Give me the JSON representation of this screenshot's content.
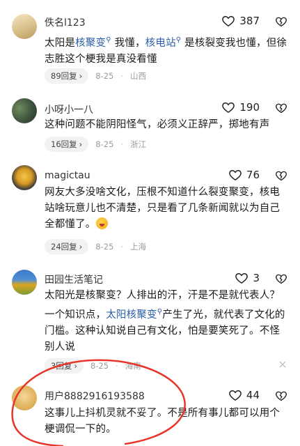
{
  "comments": [
    {
      "username": "佚名l123",
      "likes": "387",
      "text_parts": [
        "太阳是",
        "核聚变",
        "我懂，",
        "核电站",
        "是核裂变我也懂，但徐志胜这个梗我是真没看懂"
      ],
      "replies": "89回复",
      "date": "8-25",
      "location": "山西"
    },
    {
      "username": "小呀小一八",
      "likes": "190",
      "text": "这种问题不能阴阳怪气，必须义正辞严，掷地有声",
      "replies": "16回复",
      "date": "8-25",
      "location": "浙江"
    },
    {
      "username": "magictau",
      "likes": "76",
      "text": "网友大多没啥文化，压根不知道什么裂变聚变，核电站啥玩意儿也不清楚，只是看了几条新闻就以为自己全都懂了。",
      "replies": "24回复",
      "date": "8-25",
      "location": "上海"
    },
    {
      "username": "田园生活笔记",
      "likes": "3",
      "text_parts": [
        "太阳光是核聚变？人排出的汗，汗是不是就代表人？一个知识点，",
        "太阳核聚变",
        "产生了光，就代表了文化的门槛。这种认知说自己有文化，怕是要笑死了。不怪别人说"
      ],
      "replies": "3回复",
      "date": "8-25",
      "location": "海南"
    },
    {
      "username": "用户8882916193588",
      "likes": "44",
      "text": "这事儿上抖机灵就不妥了。不是所有事儿都可以用个梗调侃一下的。"
    }
  ],
  "colors": {
    "link": "#2b5fa8",
    "annotation": "#e8352a"
  },
  "icons": {
    "like": "heart-outline-icon",
    "dislike": "broken-heart-icon",
    "search": "magnifier-icon",
    "chevron": "chevron-right-icon"
  }
}
